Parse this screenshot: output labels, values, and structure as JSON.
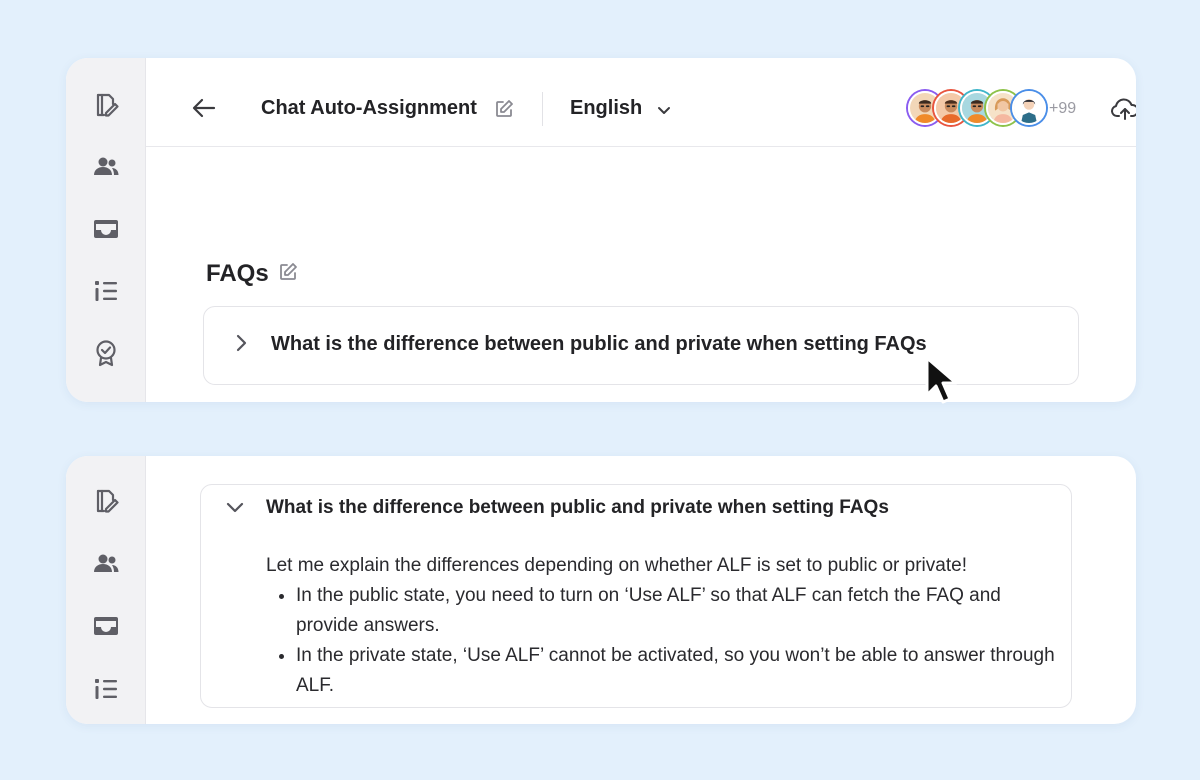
{
  "header": {
    "title": "Chat Auto-Assignment",
    "language": "English",
    "collaborators_more": "+99"
  },
  "faq": {
    "title": "FAQs",
    "question": "What is the difference between public and private when setting FAQs",
    "answer_intro": "Let me explain the differences depending on whether ALF is set to public or private!",
    "answer_points": [
      "In the public state, you need to turn on ‘Use ALF’ so that ALF can fetch the FAQ and provide answers.",
      "In the private state, ‘Use ALF’ cannot be activated, so you won’t be able to answer through ALF."
    ]
  },
  "sidebar_icons": [
    "document-edit-icon",
    "users-icon",
    "inbox-icon",
    "list-icon",
    "badge-icon"
  ],
  "colors": {
    "background": "#e3f0fc",
    "card": "#ffffff",
    "rail": "#f2f2f4",
    "avatar_borders": [
      "#8a5cf0",
      "#e8553f",
      "#3fb5c9",
      "#8ec24a",
      "#4a8ee8"
    ]
  }
}
